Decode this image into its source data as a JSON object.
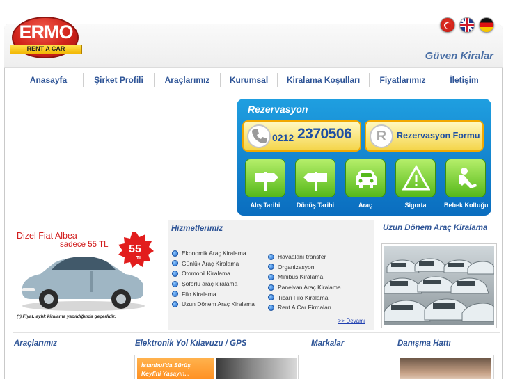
{
  "header": {
    "logo_text": "ERMO",
    "logo_sub": "RENT A CAR",
    "slogan": "Güven Kiralar",
    "flags": [
      {
        "name": "turkish-flag-icon",
        "lang": "tr"
      },
      {
        "name": "english-flag-icon",
        "lang": "en"
      },
      {
        "name": "german-flag-icon",
        "lang": "de"
      }
    ]
  },
  "nav": {
    "items": [
      "Anasayfa",
      "Şirket Profili",
      "Araçlarımız",
      "Kurumsal",
      "Kiralama Koşulları",
      "Fiyatlarımız",
      "İletişim"
    ]
  },
  "reservation": {
    "title": "Rezervasyon",
    "phone_prefix": "0212",
    "phone_number": "2370506",
    "form_letter": "R",
    "form_label": "Rezervasyon Formu",
    "icons": [
      {
        "label": "Alış Tarihi",
        "icon": "signpost-right-icon"
      },
      {
        "label": "Dönüş Tarihi",
        "icon": "signpost-left-icon"
      },
      {
        "label": "Araç",
        "icon": "car-icon"
      },
      {
        "label": "Sigorta",
        "icon": "warning-icon"
      },
      {
        "label": "Bebek Koltuğu",
        "icon": "baby-seat-icon"
      }
    ]
  },
  "promo": {
    "title": "Dizel Fiat Albea",
    "price_text": "sadece 55 TL",
    "badge_value": "55",
    "badge_unit": "TL",
    "note": "(*) Fiyat, aylık kiralama yapıldığında geçerlidir."
  },
  "services": {
    "title": "Hizmetlerimiz",
    "left": [
      "Ekonomik Araç Kiralama",
      "Günlük Araç Kiralama",
      "Otomobil Kiralama",
      "Şoförlü araç kiralama",
      "Filo Kiralama",
      "Uzun Dönem Araç Kiralama"
    ],
    "right": [
      "Havaalanı transfer",
      "Organizasyon",
      "Minibüs Kiralama",
      "Panelvan Araç Kiralama",
      "Ticari Filo Kiralama",
      "Rent A Car Firmaları"
    ],
    "more": ">> Devamı"
  },
  "longterm": {
    "title": "Uzun Dönem Araç Kiralama"
  },
  "bottom": {
    "cars_title": "Araçlarımız",
    "gps_title": "Elektronik Yol Kılavuzu / GPS",
    "gps_promo_line1": "İstanbul'da Sürüş",
    "gps_promo_line2": "Keyfini Yaşayın...",
    "brands_title": "Markalar",
    "help_title": "Danışma Hattı"
  },
  "colors": {
    "brand_red": "#d1231b",
    "nav_blue": "#2f5597",
    "reservation_blue": "#0a6dbf",
    "reservation_green": "#56b91a",
    "promo_red": "#d11a1a"
  }
}
